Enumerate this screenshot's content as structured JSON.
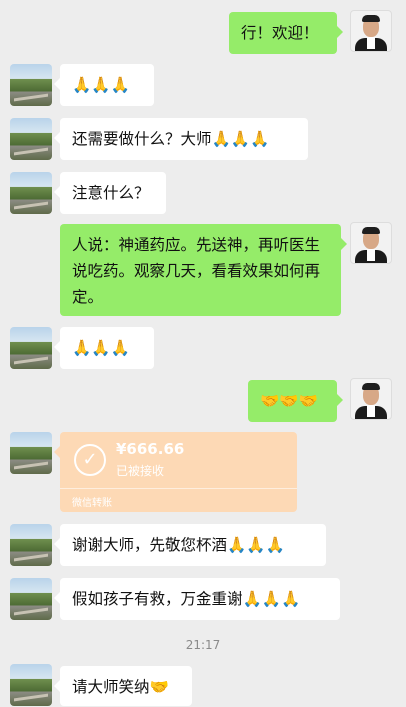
{
  "messages": [
    {
      "side": "right",
      "text": "行！欢迎！"
    },
    {
      "side": "left",
      "text": "🙏🙏🙏"
    },
    {
      "side": "left",
      "text": "还需要做什么？大师🙏🙏🙏"
    },
    {
      "side": "left",
      "text": "注意什么？"
    },
    {
      "side": "right",
      "text": "人说：神通药应。先送神，再听医生说吃药。观察几天，看看效果如何再定。"
    },
    {
      "side": "left",
      "text": "🙏🙏🙏"
    },
    {
      "side": "right",
      "text": "🤝🤝🤝"
    },
    {
      "side": "left",
      "type": "transfer",
      "amount": "¥666.66",
      "status": "已被接收",
      "footer": "微信转账"
    },
    {
      "side": "left",
      "text": "谢谢大师，先敬您杯酒🙏🙏🙏"
    },
    {
      "side": "left",
      "text": "假如孩子有救，万金重谢🙏🙏🙏"
    },
    {
      "type": "time",
      "text": "21:17"
    },
    {
      "side": "left",
      "text": "请大师笑纳🤝"
    }
  ],
  "colors": {
    "background": "#ededed",
    "sent_bubble": "#95ec69",
    "received_bubble": "#ffffff",
    "transfer_card": "#fdd9b5"
  },
  "icons": {
    "transfer": "check-circle-icon",
    "avatar_left": "landscape-avatar",
    "avatar_right": "person-avatar"
  }
}
